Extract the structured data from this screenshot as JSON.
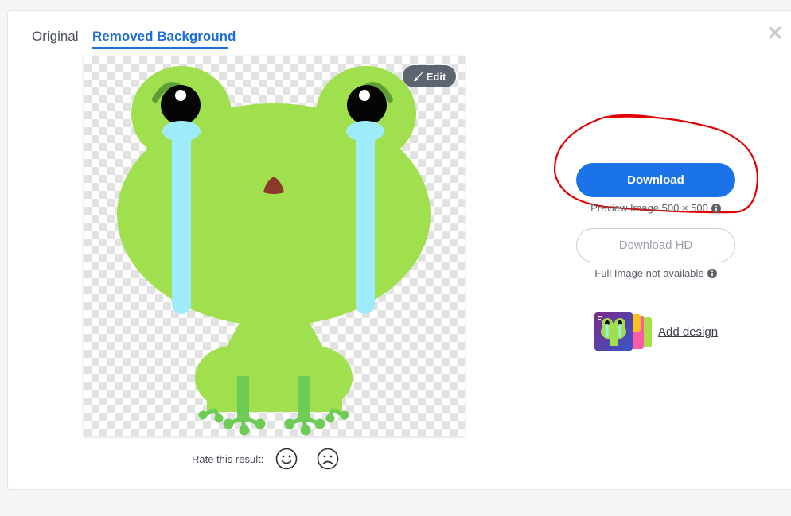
{
  "tabs": [
    {
      "label": "Original"
    },
    {
      "label": "Removed Background"
    }
  ],
  "image": {
    "edit_label": "Edit"
  },
  "rating": {
    "label": "Rate this result:"
  },
  "download": {
    "label": "Download",
    "preview_note": "Preview Image 500 × 500"
  },
  "download_hd": {
    "label": "Download HD",
    "note": "Full Image not available"
  },
  "add_design": {
    "label": "Add design"
  },
  "colors": {
    "accent": "#1a73e8",
    "frog": "#a0e04e",
    "tear": "#9eecfb",
    "annotation": "#e00000"
  },
  "icons": [
    "close-icon",
    "brush-icon",
    "info-icon",
    "smile-icon",
    "frown-icon"
  ]
}
